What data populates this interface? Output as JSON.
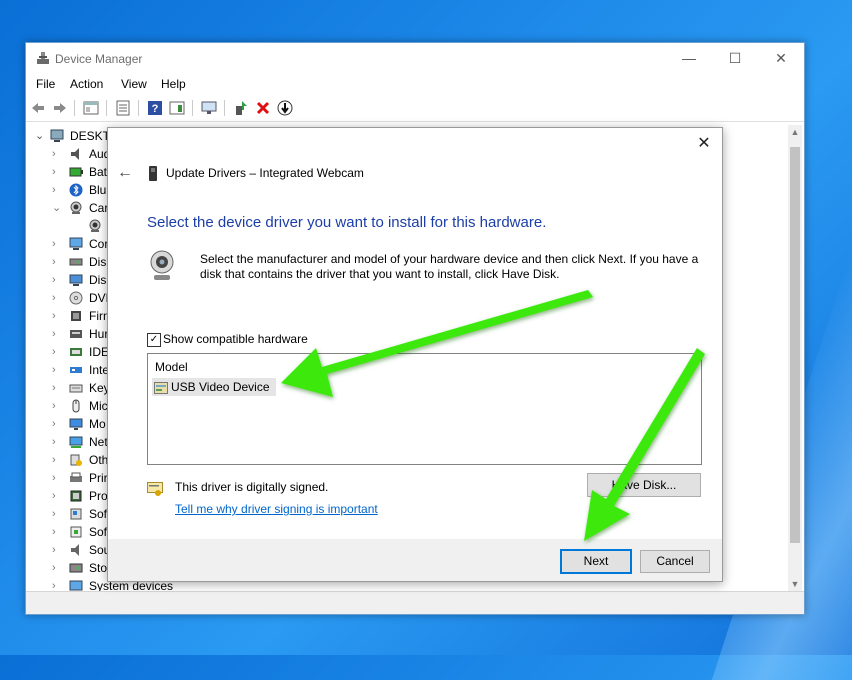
{
  "window": {
    "title": "Device Manager",
    "controls": {
      "minimize": "—",
      "maximize": "☐",
      "close": "✕"
    }
  },
  "menu": [
    "File",
    "Action",
    "View",
    "Help"
  ],
  "toolbar": [
    "back-icon",
    "forward-icon",
    "properties-icon",
    "show-hide-icon",
    "help-icon",
    "action-pane-icon",
    "scan-hardware-icon",
    "update-driver-icon",
    "uninstall-icon",
    "disable-icon"
  ],
  "tree": {
    "root": "DESKTO",
    "items": [
      {
        "label": "Aud",
        "chevron": "›",
        "icon": "audio-icon"
      },
      {
        "label": "Bat",
        "chevron": "›",
        "icon": "battery-icon"
      },
      {
        "label": "Blu",
        "chevron": "›",
        "icon": "bluetooth-icon"
      },
      {
        "label": "Car",
        "chevron": "⌄",
        "icon": "camera-icon"
      },
      {
        "label": "",
        "chevron": "",
        "icon": "webcam-icon"
      },
      {
        "label": "Cor",
        "chevron": "›",
        "icon": "computer-icon"
      },
      {
        "label": "Disl",
        "chevron": "›",
        "icon": "disk-icon"
      },
      {
        "label": "Disp",
        "chevron": "›",
        "icon": "display-icon"
      },
      {
        "label": "DVD",
        "chevron": "›",
        "icon": "dvd-icon"
      },
      {
        "label": "Firn",
        "chevron": "›",
        "icon": "firmware-icon"
      },
      {
        "label": "Hur",
        "chevron": "›",
        "icon": "hid-icon"
      },
      {
        "label": "IDE",
        "chevron": "›",
        "icon": "ide-icon"
      },
      {
        "label": "Inte",
        "chevron": "›",
        "icon": "interface-icon"
      },
      {
        "label": "Key",
        "chevron": "›",
        "icon": "keyboard-icon"
      },
      {
        "label": "Mic",
        "chevron": "›",
        "icon": "mouse-icon"
      },
      {
        "label": "Mo",
        "chevron": "›",
        "icon": "monitor-icon"
      },
      {
        "label": "Net",
        "chevron": "›",
        "icon": "network-icon"
      },
      {
        "label": "Oth",
        "chevron": "›",
        "icon": "other-devices-icon"
      },
      {
        "label": "Prir",
        "chevron": "›",
        "icon": "printer-icon"
      },
      {
        "label": "Pro",
        "chevron": "›",
        "icon": "processor-icon"
      },
      {
        "label": "Sof",
        "chevron": "›",
        "icon": "software-component-icon"
      },
      {
        "label": "Sof",
        "chevron": "›",
        "icon": "software-device-icon"
      },
      {
        "label": "Sou",
        "chevron": "›",
        "icon": "sound-icon"
      },
      {
        "label": "Sto",
        "chevron": "›",
        "icon": "storage-icon"
      },
      {
        "label": "System devices",
        "chevron": "›",
        "icon": "system-devices-icon"
      }
    ]
  },
  "dialog": {
    "title": "Update Drivers – Integrated Webcam",
    "close": "✕",
    "back": "←",
    "heading": "Select the device driver you want to install for this hardware.",
    "instructions": "Select the manufacturer and model of your hardware device and then click Next. If you have a disk that contains the driver that you want to install, click Have Disk.",
    "show_compatible_label": "Show compatible hardware",
    "show_compatible_checked": true,
    "checkmark": "✓",
    "list_header": "Model",
    "models": [
      "USB Video Device"
    ],
    "have_disk_label": "Have Disk...",
    "signed_text": "This driver is digitally signed.",
    "signing_link": "Tell me why driver signing is important",
    "next_label": "Next",
    "cancel_label": "Cancel"
  },
  "colors": {
    "heading": "#1c3ea8",
    "link": "#0066cc",
    "arrow": "#3ee80e",
    "focus": "#0078d7"
  }
}
